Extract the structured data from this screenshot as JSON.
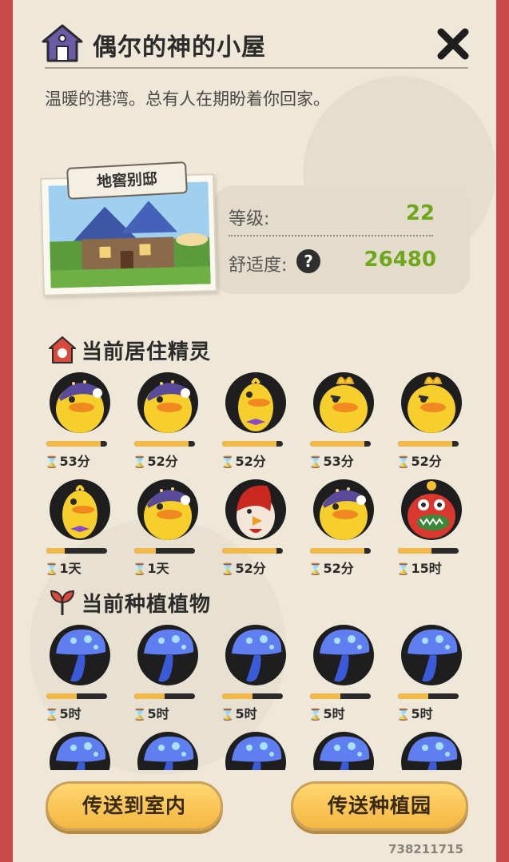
{
  "header": {
    "title": "偶尔的神的小屋",
    "description": "温暖的港湾。总有人在期盼着你回家。"
  },
  "house": {
    "tag": "地窖别邸",
    "level_label": "等级:",
    "level_value": "22",
    "comfort_label": "舒适度:",
    "comfort_value": "26480",
    "help_icon": "?"
  },
  "spirits": {
    "title": "当前居住精灵",
    "items": [
      {
        "kind": "duck-nightcap",
        "timer": "53分",
        "progress": 0.9
      },
      {
        "kind": "duck-nightcap",
        "timer": "52分",
        "progress": 0.9
      },
      {
        "kind": "duck-bowtie",
        "timer": "52分",
        "progress": 0.9
      },
      {
        "kind": "duck-crest",
        "timer": "53分",
        "progress": 0.9
      },
      {
        "kind": "duck-crest",
        "timer": "52分",
        "progress": 0.9
      },
      {
        "kind": "duck-bowtie",
        "timer": "1天",
        "progress": 0.3
      },
      {
        "kind": "duck-nightcap",
        "timer": "1天",
        "progress": 0.35
      },
      {
        "kind": "red-bird",
        "timer": "52分",
        "progress": 0.9
      },
      {
        "kind": "duck-nightcap",
        "timer": "52分",
        "progress": 0.9
      },
      {
        "kind": "red-fish",
        "timer": "15时",
        "progress": 0.55
      }
    ]
  },
  "plants": {
    "title": "当前种植植物",
    "items": [
      {
        "kind": "blue-mushroom",
        "timer": "5时",
        "progress": 0.5
      },
      {
        "kind": "blue-mushroom",
        "timer": "5时",
        "progress": 0.5
      },
      {
        "kind": "blue-mushroom",
        "timer": "5时",
        "progress": 0.5
      },
      {
        "kind": "blue-mushroom",
        "timer": "5时",
        "progress": 0.5
      },
      {
        "kind": "blue-mushroom",
        "timer": "5时",
        "progress": 0.5
      },
      {
        "kind": "blue-mushroom",
        "timer": "",
        "progress": 0.5
      },
      {
        "kind": "blue-mushroom",
        "timer": "",
        "progress": 0.5
      },
      {
        "kind": "blue-mushroom",
        "timer": "",
        "progress": 0.5
      },
      {
        "kind": "blue-mushroom",
        "timer": "",
        "progress": 0.5
      },
      {
        "kind": "blue-mushroom",
        "timer": "",
        "progress": 0.5
      }
    ]
  },
  "buttons": {
    "teleport_indoor": "传送到室内",
    "teleport_garden": "传送种植园"
  },
  "uid": "738211715",
  "colors": {
    "panel": "#efe8d8",
    "border": "#c94a4a",
    "accent_green": "#6ea61c",
    "button": "#f4b741"
  }
}
